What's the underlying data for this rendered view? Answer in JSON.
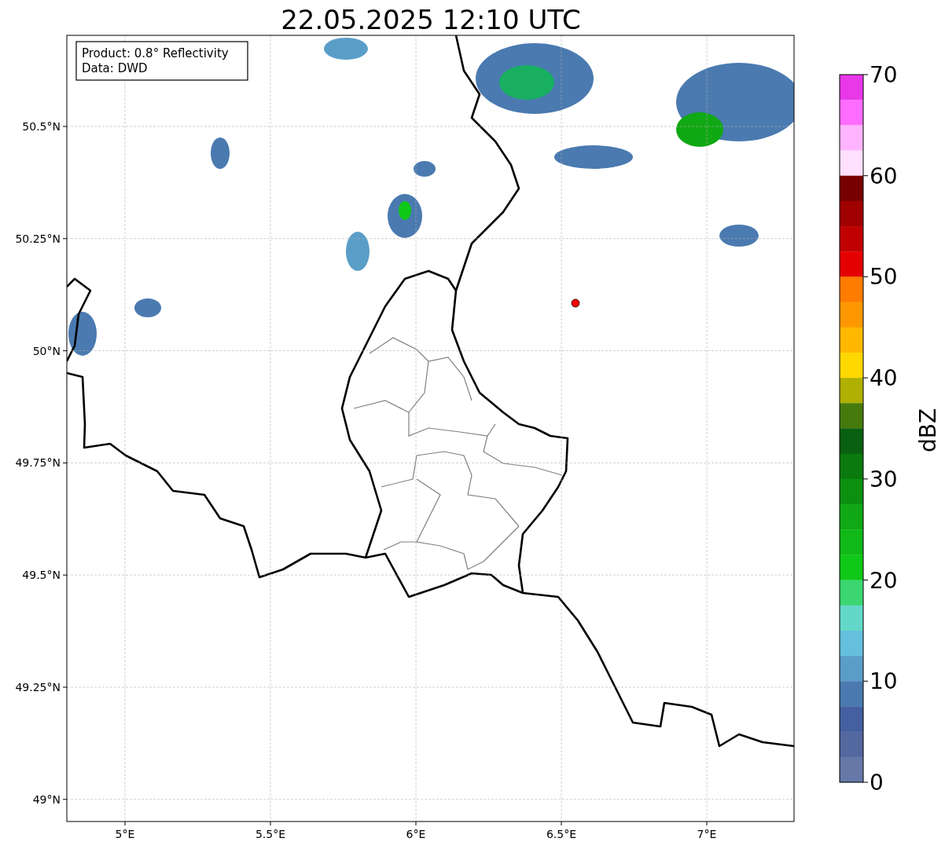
{
  "title": "22.05.2025 12:10 UTC",
  "legend": {
    "lines": [
      "Product: 0.8° Reflectivity",
      "Data: DWD"
    ]
  },
  "y_axis": {
    "ticks": [
      "50.5°N",
      "50.25°N",
      "50°N",
      "49.75°N",
      "49.5°N",
      "49.25°N",
      "49°N"
    ]
  },
  "x_axis": {
    "ticks": [
      "5°E",
      "5.5°E",
      "6°E",
      "6.5°E",
      "7°E"
    ]
  },
  "colorbar": {
    "label": "dBZ",
    "ticks": [
      "70",
      "60",
      "50",
      "40",
      "30",
      "20",
      "10",
      "0"
    ],
    "bands": [
      {
        "color": "#e838e8"
      },
      {
        "color": "#ff6cff"
      },
      {
        "color": "#ffb4ff"
      },
      {
        "color": "#ffe0ff"
      },
      {
        "color": "#780000"
      },
      {
        "color": "#a00000"
      },
      {
        "color": "#c00000"
      },
      {
        "color": "#e40000"
      },
      {
        "color": "#ff7c00"
      },
      {
        "color": "#ff9800"
      },
      {
        "color": "#ffb800"
      },
      {
        "color": "#ffd800"
      },
      {
        "color": "#b0b000"
      },
      {
        "color": "#467a0c"
      },
      {
        "color": "#086010"
      },
      {
        "color": "#0a7a0e"
      },
      {
        "color": "#0c9010"
      },
      {
        "color": "#10a814"
      },
      {
        "color": "#10b818"
      },
      {
        "color": "#10c818"
      },
      {
        "color": "#3cd670"
      },
      {
        "color": "#64d8c8"
      },
      {
        "color": "#64c0dc"
      },
      {
        "color": "#5a9ec8"
      },
      {
        "color": "#4a7ab0"
      },
      {
        "color": "#4460a0"
      },
      {
        "color": "#5468a0"
      },
      {
        "color": "#6678a8"
      }
    ]
  }
}
